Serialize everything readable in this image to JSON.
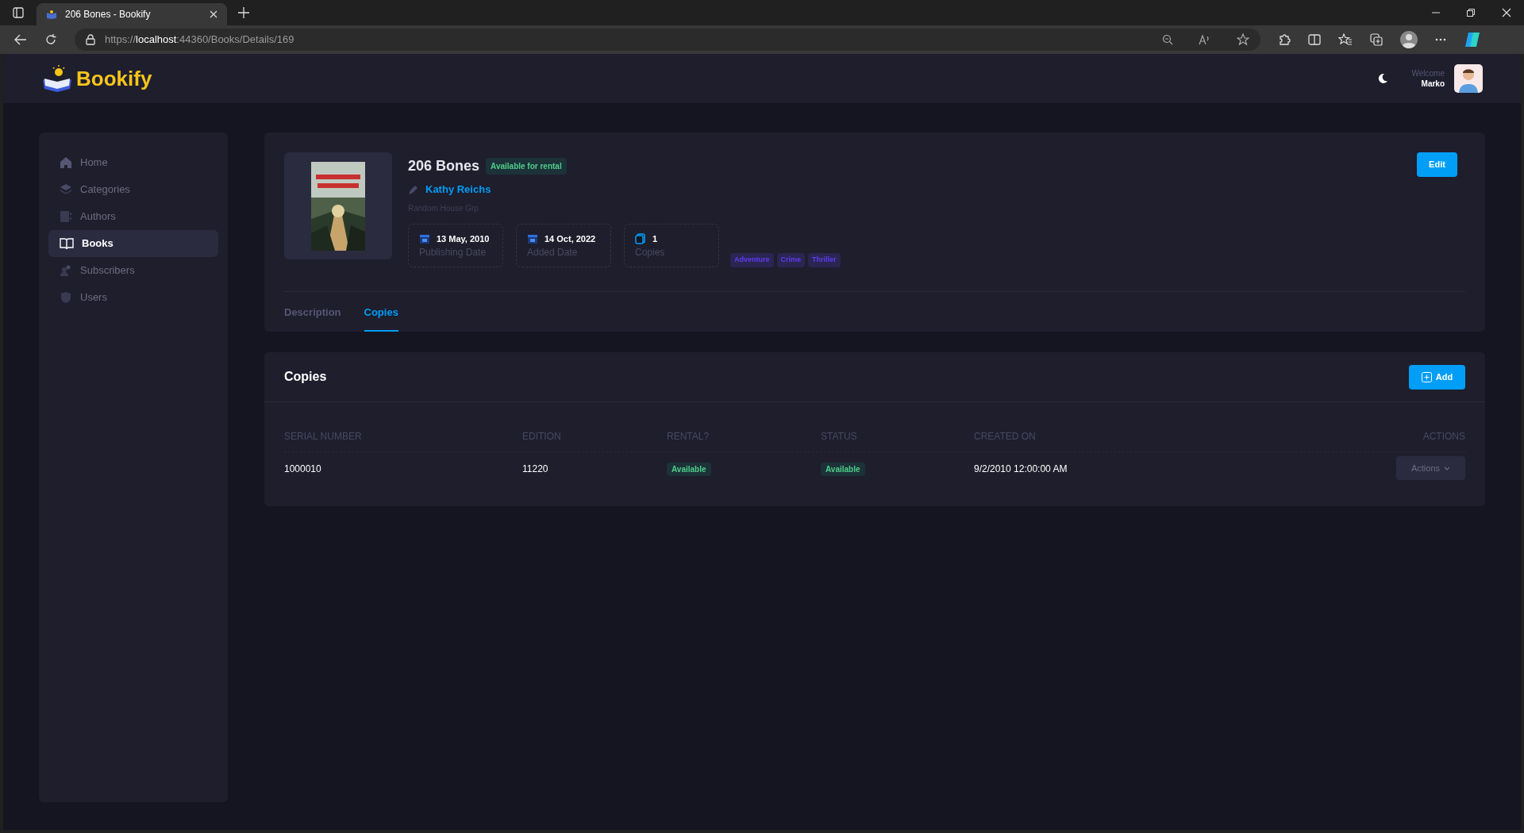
{
  "browser": {
    "tab_title": "206 Bones - Bookify",
    "url_scheme": "https://",
    "url_host": "localhost",
    "url_path": ":44360/Books/Details/169"
  },
  "header": {
    "logo": "Bookify",
    "welcome": "Welcome",
    "user": "Marko"
  },
  "sidebar": {
    "items": [
      {
        "label": "Home",
        "selected": false
      },
      {
        "label": "Categories",
        "selected": false
      },
      {
        "label": "Authors",
        "selected": false
      },
      {
        "label": "Books",
        "selected": true
      },
      {
        "label": "Subscribers",
        "selected": false
      },
      {
        "label": "Users",
        "selected": false
      }
    ]
  },
  "book": {
    "title": "206 Bones",
    "status": "Available for rental",
    "author": "Kathy Reichs",
    "publisher": "Random House Grp",
    "stats": [
      {
        "value": "13 May, 2010",
        "label": "Publishing Date",
        "kind": "date"
      },
      {
        "value": "14 Oct, 2022",
        "label": "Added Date",
        "kind": "date"
      },
      {
        "value": "1",
        "label": "Copies",
        "kind": "copies"
      }
    ],
    "tags": [
      "Adventure",
      "Crime",
      "Thriller"
    ],
    "edit_button": "Edit",
    "tabs": [
      {
        "label": "Description",
        "selected": false
      },
      {
        "label": "Copies",
        "selected": true
      }
    ]
  },
  "copies": {
    "title": "Copies",
    "add_button": "Add",
    "table": {
      "columns": [
        "SERIAL NUMBER",
        "EDITION",
        "RENTAL?",
        "STATUS",
        "CREATED ON",
        "ACTIONS"
      ],
      "rows": [
        {
          "serial": "1000010",
          "edition": "11220",
          "rental": "Available",
          "status": "Available",
          "created": "9/2/2010 12:00:00 AM",
          "action": "Actions"
        }
      ]
    }
  }
}
